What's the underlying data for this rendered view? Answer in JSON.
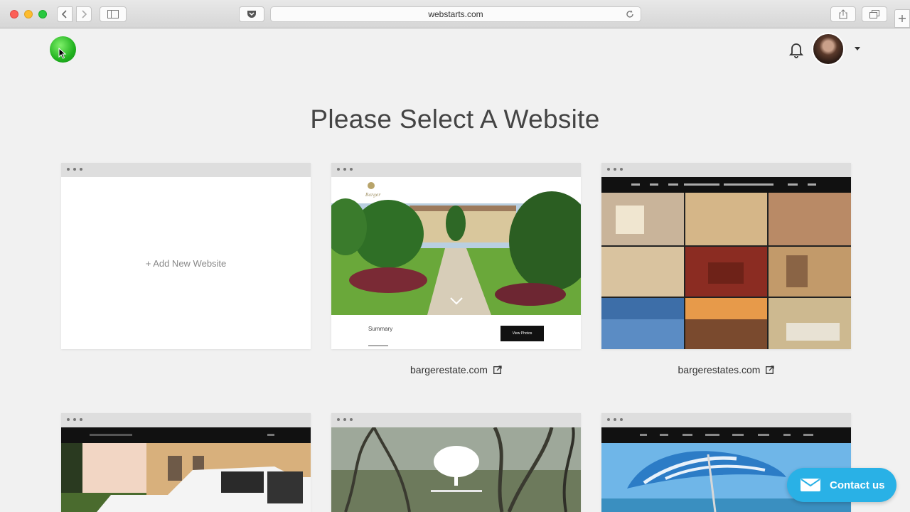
{
  "browser": {
    "url": "webstarts.com"
  },
  "page": {
    "title": "Please Select A Website"
  },
  "cards": {
    "add_new": "+ Add New Website",
    "site1": {
      "domain": "bargerestate.com",
      "summary_label": "Summary",
      "cta": "View Photos"
    },
    "site2": {
      "domain": "bargerestates.com"
    }
  },
  "contact": {
    "label": "Contact us"
  },
  "colors": {
    "accent": "#29b1e6",
    "brand": "#21b21f"
  }
}
